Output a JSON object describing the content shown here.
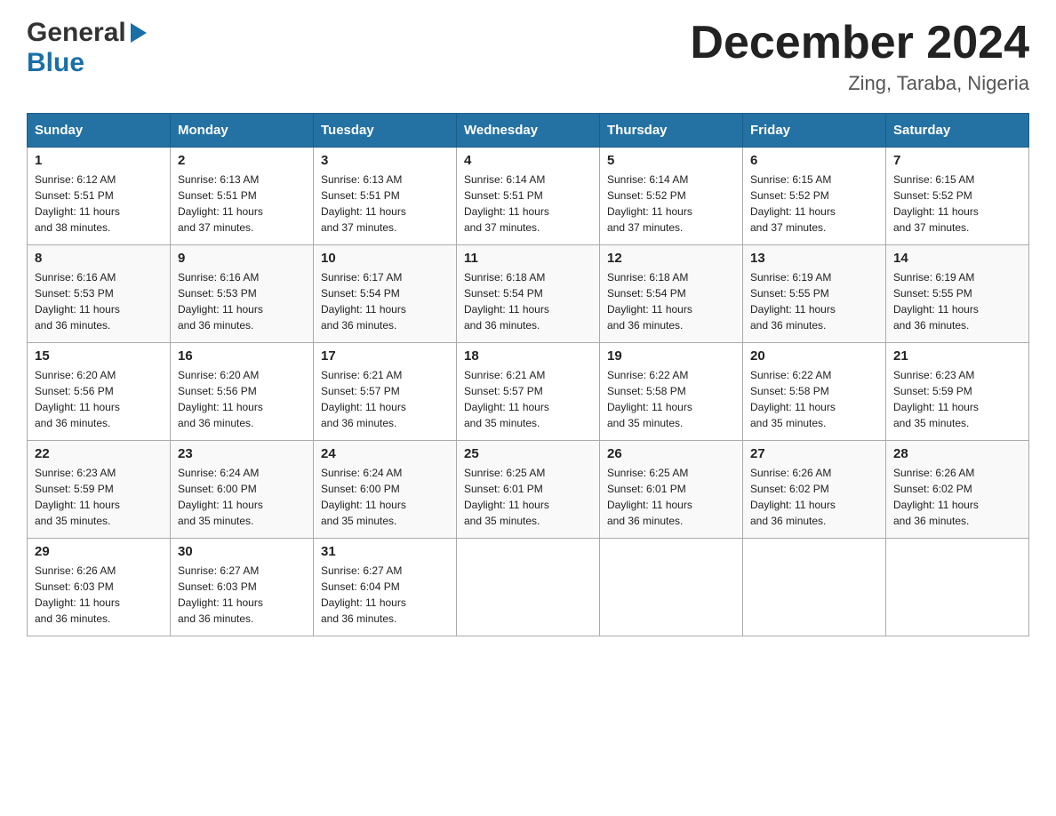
{
  "header": {
    "logo_general": "General",
    "logo_blue": "Blue",
    "month_title": "December 2024",
    "location": "Zing, Taraba, Nigeria"
  },
  "days_of_week": [
    "Sunday",
    "Monday",
    "Tuesday",
    "Wednesday",
    "Thursday",
    "Friday",
    "Saturday"
  ],
  "weeks": [
    [
      {
        "day": "1",
        "sunrise": "6:12 AM",
        "sunset": "5:51 PM",
        "daylight": "11 hours and 38 minutes."
      },
      {
        "day": "2",
        "sunrise": "6:13 AM",
        "sunset": "5:51 PM",
        "daylight": "11 hours and 37 minutes."
      },
      {
        "day": "3",
        "sunrise": "6:13 AM",
        "sunset": "5:51 PM",
        "daylight": "11 hours and 37 minutes."
      },
      {
        "day": "4",
        "sunrise": "6:14 AM",
        "sunset": "5:51 PM",
        "daylight": "11 hours and 37 minutes."
      },
      {
        "day": "5",
        "sunrise": "6:14 AM",
        "sunset": "5:52 PM",
        "daylight": "11 hours and 37 minutes."
      },
      {
        "day": "6",
        "sunrise": "6:15 AM",
        "sunset": "5:52 PM",
        "daylight": "11 hours and 37 minutes."
      },
      {
        "day": "7",
        "sunrise": "6:15 AM",
        "sunset": "5:52 PM",
        "daylight": "11 hours and 37 minutes."
      }
    ],
    [
      {
        "day": "8",
        "sunrise": "6:16 AM",
        "sunset": "5:53 PM",
        "daylight": "11 hours and 36 minutes."
      },
      {
        "day": "9",
        "sunrise": "6:16 AM",
        "sunset": "5:53 PM",
        "daylight": "11 hours and 36 minutes."
      },
      {
        "day": "10",
        "sunrise": "6:17 AM",
        "sunset": "5:54 PM",
        "daylight": "11 hours and 36 minutes."
      },
      {
        "day": "11",
        "sunrise": "6:18 AM",
        "sunset": "5:54 PM",
        "daylight": "11 hours and 36 minutes."
      },
      {
        "day": "12",
        "sunrise": "6:18 AM",
        "sunset": "5:54 PM",
        "daylight": "11 hours and 36 minutes."
      },
      {
        "day": "13",
        "sunrise": "6:19 AM",
        "sunset": "5:55 PM",
        "daylight": "11 hours and 36 minutes."
      },
      {
        "day": "14",
        "sunrise": "6:19 AM",
        "sunset": "5:55 PM",
        "daylight": "11 hours and 36 minutes."
      }
    ],
    [
      {
        "day": "15",
        "sunrise": "6:20 AM",
        "sunset": "5:56 PM",
        "daylight": "11 hours and 36 minutes."
      },
      {
        "day": "16",
        "sunrise": "6:20 AM",
        "sunset": "5:56 PM",
        "daylight": "11 hours and 36 minutes."
      },
      {
        "day": "17",
        "sunrise": "6:21 AM",
        "sunset": "5:57 PM",
        "daylight": "11 hours and 36 minutes."
      },
      {
        "day": "18",
        "sunrise": "6:21 AM",
        "sunset": "5:57 PM",
        "daylight": "11 hours and 35 minutes."
      },
      {
        "day": "19",
        "sunrise": "6:22 AM",
        "sunset": "5:58 PM",
        "daylight": "11 hours and 35 minutes."
      },
      {
        "day": "20",
        "sunrise": "6:22 AM",
        "sunset": "5:58 PM",
        "daylight": "11 hours and 35 minutes."
      },
      {
        "day": "21",
        "sunrise": "6:23 AM",
        "sunset": "5:59 PM",
        "daylight": "11 hours and 35 minutes."
      }
    ],
    [
      {
        "day": "22",
        "sunrise": "6:23 AM",
        "sunset": "5:59 PM",
        "daylight": "11 hours and 35 minutes."
      },
      {
        "day": "23",
        "sunrise": "6:24 AM",
        "sunset": "6:00 PM",
        "daylight": "11 hours and 35 minutes."
      },
      {
        "day": "24",
        "sunrise": "6:24 AM",
        "sunset": "6:00 PM",
        "daylight": "11 hours and 35 minutes."
      },
      {
        "day": "25",
        "sunrise": "6:25 AM",
        "sunset": "6:01 PM",
        "daylight": "11 hours and 35 minutes."
      },
      {
        "day": "26",
        "sunrise": "6:25 AM",
        "sunset": "6:01 PM",
        "daylight": "11 hours and 36 minutes."
      },
      {
        "day": "27",
        "sunrise": "6:26 AM",
        "sunset": "6:02 PM",
        "daylight": "11 hours and 36 minutes."
      },
      {
        "day": "28",
        "sunrise": "6:26 AM",
        "sunset": "6:02 PM",
        "daylight": "11 hours and 36 minutes."
      }
    ],
    [
      {
        "day": "29",
        "sunrise": "6:26 AM",
        "sunset": "6:03 PM",
        "daylight": "11 hours and 36 minutes."
      },
      {
        "day": "30",
        "sunrise": "6:27 AM",
        "sunset": "6:03 PM",
        "daylight": "11 hours and 36 minutes."
      },
      {
        "day": "31",
        "sunrise": "6:27 AM",
        "sunset": "6:04 PM",
        "daylight": "11 hours and 36 minutes."
      },
      null,
      null,
      null,
      null
    ]
  ],
  "sunrise_label": "Sunrise:",
  "sunset_label": "Sunset:",
  "daylight_label": "Daylight:"
}
